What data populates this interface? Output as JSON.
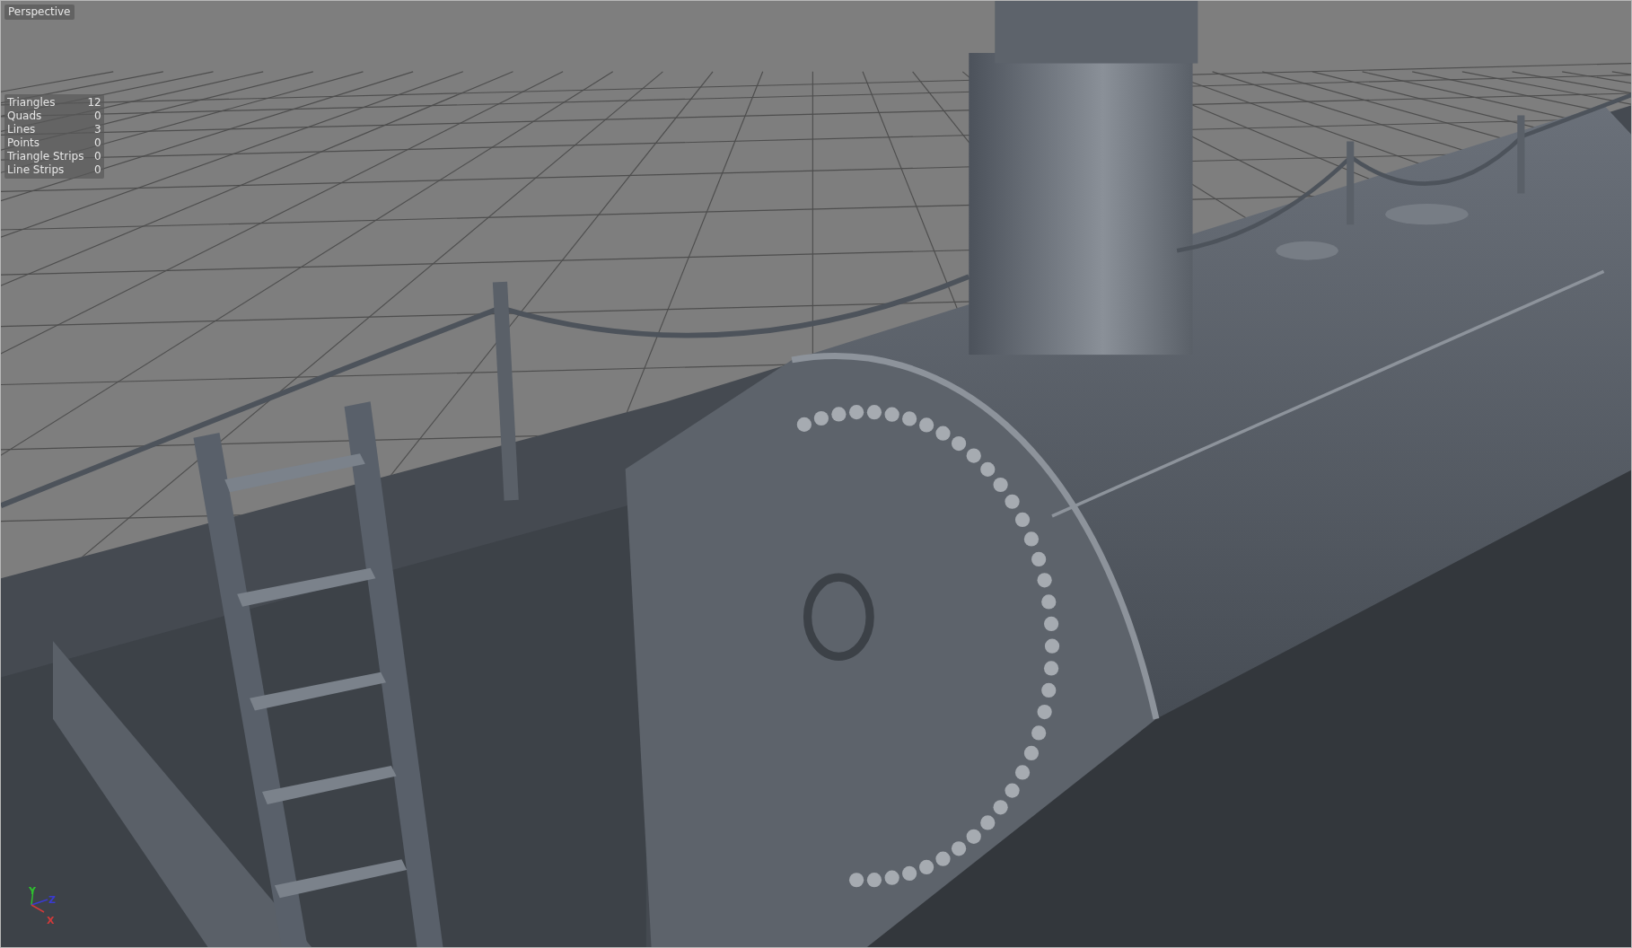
{
  "viewport": {
    "label": "Perspective"
  },
  "stats": [
    {
      "name": "Triangles",
      "value": "12"
    },
    {
      "name": "Quads",
      "value": "0"
    },
    {
      "name": "Lines",
      "value": "3"
    },
    {
      "name": "Points",
      "value": "0"
    },
    {
      "name": "Triangle Strips",
      "value": "0"
    },
    {
      "name": "Line Strips",
      "value": "0"
    }
  ],
  "axes": [
    {
      "kind": "y",
      "label": "Y",
      "color": "#2fbf2f"
    },
    {
      "kind": "z",
      "label": "Z",
      "color": "#3a3ad0"
    },
    {
      "kind": "x",
      "label": "X",
      "color": "#d03a3a"
    }
  ]
}
